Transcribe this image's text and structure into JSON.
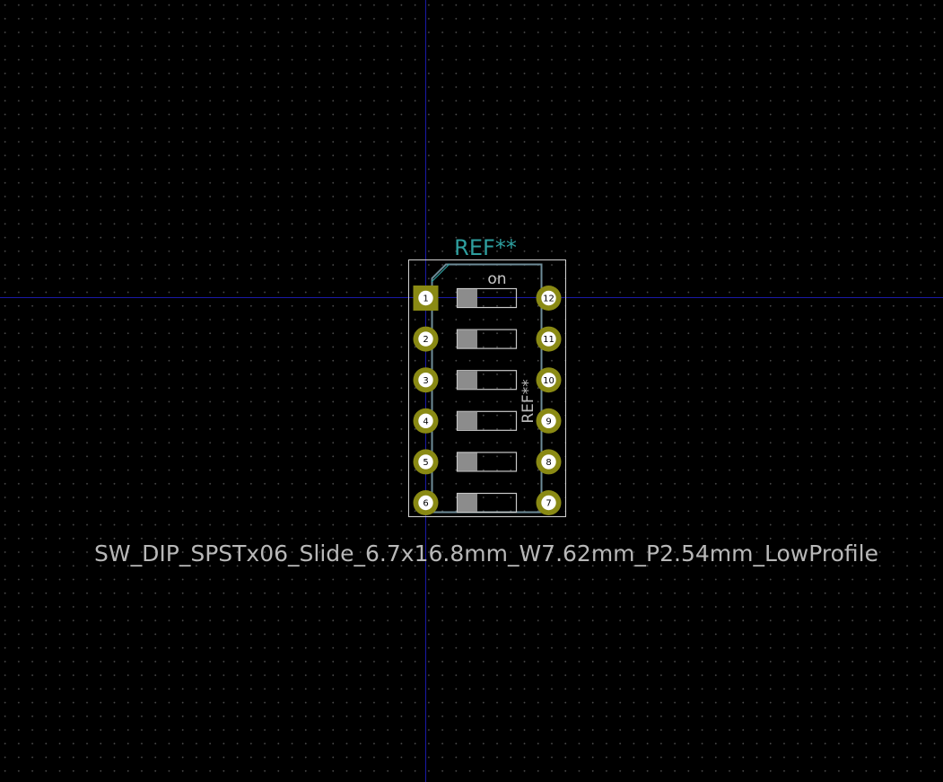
{
  "footprint": {
    "reference_top": "REF**",
    "reference_fab": "REF**",
    "value": "SW_DIP_SPSTx06_Slide_6.7x16.8mm_W7.62mm_P2.54mm_LowProfile",
    "on_label": "on",
    "switch_count": 6,
    "pads_left": [
      "1",
      "2",
      "3",
      "4",
      "5",
      "6"
    ],
    "pads_right": [
      "12",
      "11",
      "10",
      "9",
      "8",
      "7"
    ]
  },
  "colors": {
    "background": "#000000",
    "grid_dot": "#4a4a4a",
    "axis": "#1a1aa6",
    "courtyard": "#d2d2d2",
    "fab": "#6e8c98",
    "silk_text": "#2e9f9f",
    "pad": "#8a8a14",
    "pad_hole": "#ffffff",
    "fab_text": "#b8b8b8",
    "switch_outline": "#c8c8c8",
    "switch_fill": "#8c8c8c"
  }
}
